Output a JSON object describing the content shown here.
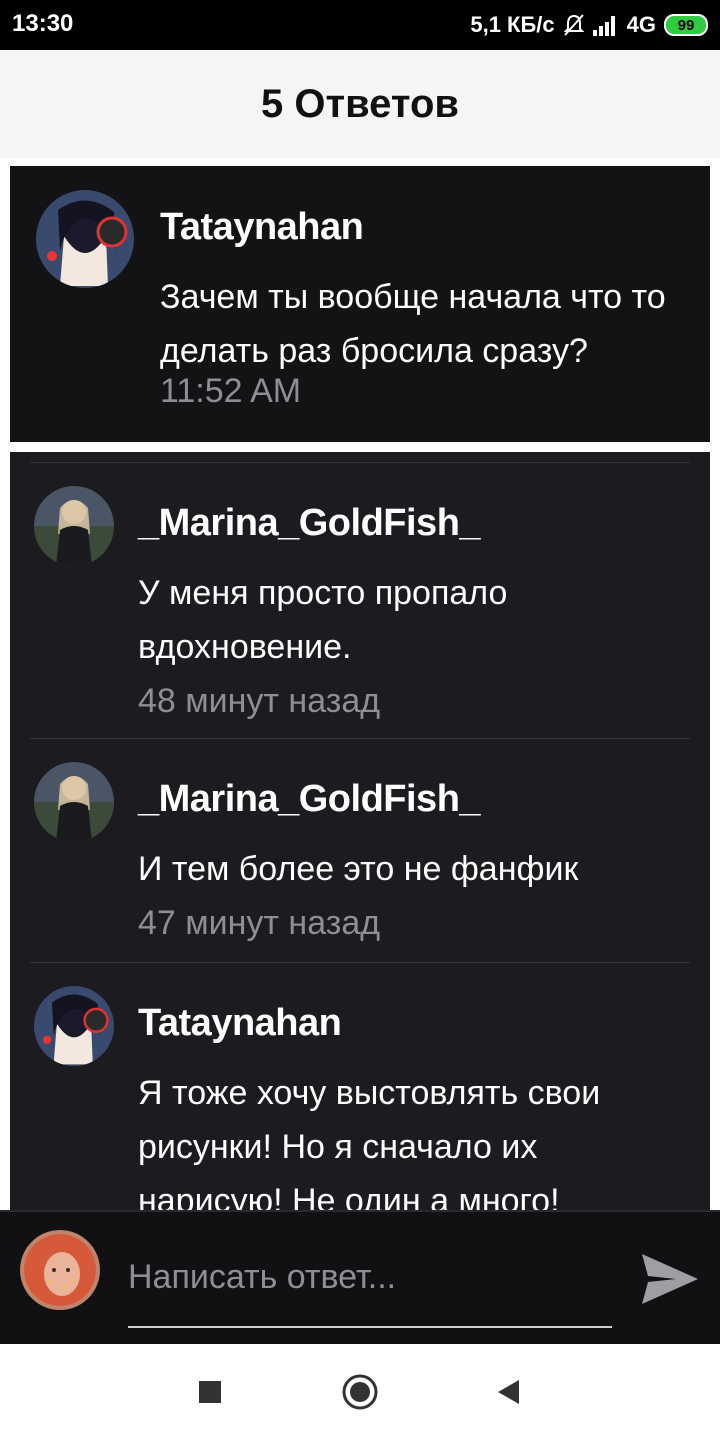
{
  "status_bar": {
    "time": "13:30",
    "net_speed": "5,1 КБ/с",
    "network": "4G",
    "battery": "99"
  },
  "header": {
    "title": "5 Ответов"
  },
  "parent_comment": {
    "author": "Tataynahan",
    "text": "Зачем ты вообще начала что то делать раз бросила сразу?",
    "time": "11:52 AM"
  },
  "replies": [
    {
      "author": "_Marina_GoldFish_",
      "text": "У меня просто пропало вдохновение.",
      "time": "48 минут назад"
    },
    {
      "author": "_Marina_GoldFish_",
      "text": "И тем более это не фанфик",
      "time": "47 минут назад"
    },
    {
      "author": "Tataynahan",
      "text": "Я тоже хочу выстовлять свои рисунки! Но я сначало их нарисую! Не один а много!"
    }
  ],
  "reply_input": {
    "placeholder": "Написать ответ..."
  },
  "colors": {
    "accent_send": "#9e9ea3",
    "card_background": "#131316",
    "replies_background": "#1c1c20",
    "muted_text": "#8e8e93"
  },
  "icons": {
    "send": "send-icon",
    "nav_back": "triangle-back-icon",
    "nav_home": "circle-home-icon",
    "nav_recents": "square-recents-icon"
  }
}
